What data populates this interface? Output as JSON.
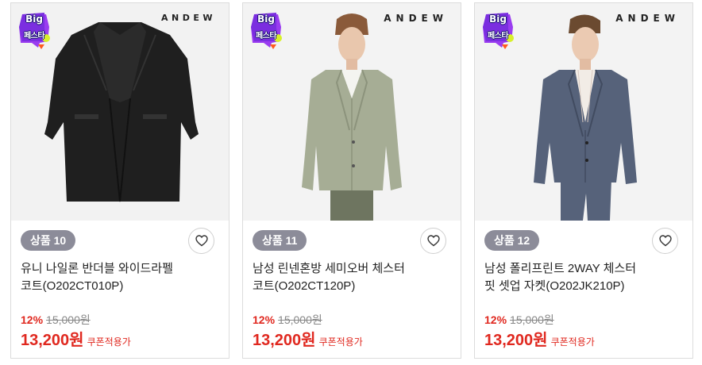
{
  "badge": {
    "line1": "Big",
    "line2": "페스타"
  },
  "products": [
    {
      "brand": "ANDEW",
      "rank": "상품 10",
      "name_line1": "유니 나일론 반더블 와이드라펠",
      "name_line2": "코트(O202CT010P)",
      "discount": "12%",
      "original_price": "15,000원",
      "sale_price": "13,200원",
      "coupon_label": "쿠폰적용가",
      "garment_color": "#1f1f1f"
    },
    {
      "brand": "ANDEW",
      "rank": "상품 11",
      "name_line1": "남성 린넨혼방 세미오버 체스터",
      "name_line2": "코트(O202CT120P)",
      "discount": "12%",
      "original_price": "15,000원",
      "sale_price": "13,200원",
      "coupon_label": "쿠폰적용가",
      "garment_color": "#a6ad95"
    },
    {
      "brand": "ANDEW",
      "rank": "상품 12",
      "name_line1": "남성 폴리프린트 2WAY 체스터",
      "name_line2": "핏 셋업 자켓(O202JK210P)",
      "discount": "12%",
      "original_price": "15,000원",
      "sale_price": "13,200원",
      "coupon_label": "쿠폰적용가",
      "garment_color": "#56627a"
    }
  ],
  "colors": {
    "accent_red": "#e0281f",
    "rank_pill": "#8c8c99"
  },
  "icons": {
    "wishlist": "heart-outline-icon",
    "promo": "big-festa-badge-icon"
  }
}
